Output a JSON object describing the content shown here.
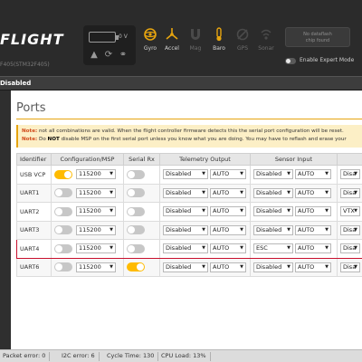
{
  "header": {
    "logo_text": "FLIGHT",
    "firmware_info": "F405(STM32F405)",
    "battery": {
      "voltage": "0 V"
    },
    "icons": [
      "warning-icon",
      "refresh-icon",
      "link-icon"
    ],
    "sensors": [
      {
        "label": "Gyro",
        "state": "on",
        "icon": "gyro-icon"
      },
      {
        "label": "Accel",
        "state": "on",
        "icon": "accel-icon"
      },
      {
        "label": "Mag",
        "state": "off",
        "icon": "mag-icon"
      },
      {
        "label": "Baro",
        "state": "on",
        "icon": "baro-icon"
      },
      {
        "label": "GPS",
        "state": "off",
        "icon": "gps-icon"
      },
      {
        "label": "Sonar",
        "state": "off",
        "icon": "sonar-icon"
      }
    ],
    "dataflash": {
      "line1": "No dataflash",
      "line2": "chip found"
    },
    "expert_mode": {
      "label": "Enable Expert Mode",
      "enabled": false
    }
  },
  "status_strip": {
    "text": "Disabled"
  },
  "page": {
    "title": "Ports",
    "note1": {
      "key": "Note:",
      "text": " not all combinations are valid. When the flight controller firmware detects this the serial port configuration will be reset."
    },
    "note2": {
      "key": "Note:",
      "pre": " Do ",
      "strong": "NOT",
      "post": " disable MSP on the first serial port unless you know what you are doing. You may have to reflash and erase your"
    }
  },
  "table": {
    "headers": {
      "identifier": "Identifier",
      "configuration": "Configuration/MSP",
      "serial_rx": "Serial Rx",
      "telemetry": "Telemetry Output",
      "sensor": "Sensor Input",
      "peripherals": ""
    },
    "rows": [
      {
        "id": "USB VCP",
        "msp": true,
        "msp_baud": "115200",
        "serial_rx": false,
        "tel": "Disabled",
        "tel_baud": "AUTO",
        "sensor": "Disabled",
        "sensor_baud": "AUTO",
        "periph": "Disa"
      },
      {
        "id": "UART1",
        "msp": false,
        "msp_baud": "115200",
        "serial_rx": false,
        "tel": "Disabled",
        "tel_baud": "AUTO",
        "sensor": "Disabled",
        "sensor_baud": "AUTO",
        "periph": "Disa"
      },
      {
        "id": "UART2",
        "msp": false,
        "msp_baud": "115200",
        "serial_rx": false,
        "tel": "Disabled",
        "tel_baud": "AUTO",
        "sensor": "Disabled",
        "sensor_baud": "AUTO",
        "periph": "VTX"
      },
      {
        "id": "UART3",
        "msp": false,
        "msp_baud": "115200",
        "serial_rx": false,
        "tel": "Disabled",
        "tel_baud": "AUTO",
        "sensor": "Disabled",
        "sensor_baud": "AUTO",
        "periph": "Disa"
      },
      {
        "id": "UART4",
        "msp": false,
        "msp_baud": "115200",
        "serial_rx": false,
        "tel": "Disabled",
        "tel_baud": "AUTO",
        "sensor": "ESC",
        "sensor_baud": "AUTO",
        "periph": "Disa",
        "highlight": true
      },
      {
        "id": "UART6",
        "msp": false,
        "msp_baud": "115200",
        "serial_rx": true,
        "tel": "Disabled",
        "tel_baud": "AUTO",
        "sensor": "Disabled",
        "sensor_baud": "AUTO",
        "periph": "Disa"
      }
    ]
  },
  "status_bar": {
    "packet_error": "Packet error: 0",
    "i2c_error": "I2C error: 6",
    "cycle_time": "Cycle Time: 130",
    "cpu_load": "CPU Load: 13%"
  },
  "colors": {
    "accent": "#e6a40f",
    "toggle_on": "#ffbb00",
    "highlight_border": "#c8102e",
    "header_bg": "#2b2b2b"
  }
}
